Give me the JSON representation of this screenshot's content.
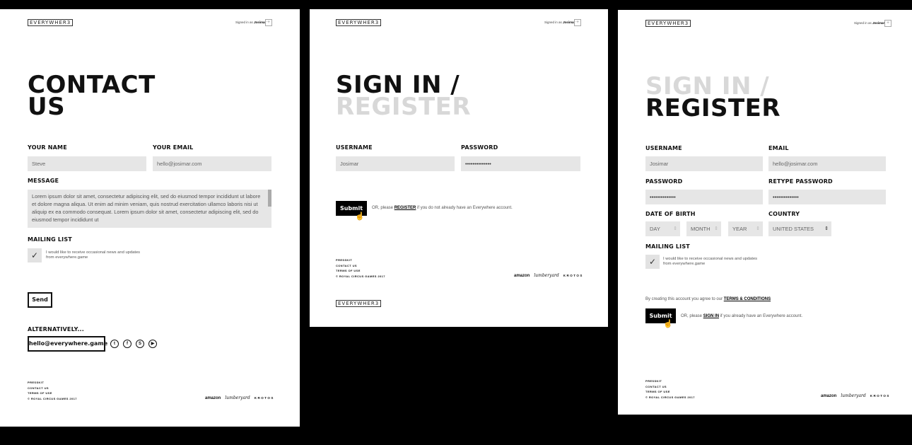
{
  "brand": {
    "logo": "EVERYWHER3"
  },
  "header": {
    "signed_in_prefix": "Signed in as",
    "user": "Josimar",
    "plus_icon": "+"
  },
  "contact": {
    "title_line1": "CONTACT",
    "title_line2": "US",
    "name_label": "YOUR NAME",
    "name_value": "Steve",
    "email_label": "YOUR EMAIL",
    "email_value": "hello@josimar.com",
    "message_label": "MESSAGE",
    "message_value": "Lorem ipsum dolor sit amet, consectetur adipiscing elit, sed do eiusmod tempor incididunt ut labore et dolore magna aliqua. Ut enim ad minim veniam, quis nostrud exercitation ullamco laboris nisi ut aliquip ex ea commodo consequat. Lorem ipsum dolor sit amet, consectetur adipiscing elit, sed do eiusmod tempor incididunt ut",
    "mailing_label": "MAILING LIST",
    "mailing_text": "I would like to receive occasional news and updates from everywhere.game",
    "mailing_checked": true,
    "send_label": "Send",
    "alt_label": "ALTERNATIVELY...",
    "alt_email": "hello@everywhere.game",
    "social": [
      {
        "name": "twitter-icon",
        "glyph": "t"
      },
      {
        "name": "facebook-icon",
        "glyph": "f"
      },
      {
        "name": "skype-icon",
        "glyph": "S"
      },
      {
        "name": "youtube-icon",
        "glyph": "▶"
      }
    ]
  },
  "signin": {
    "title_line1": "SIGN IN /",
    "title_line2": "REGISTER",
    "username_label": "USERNAME",
    "username_value": "Josimar",
    "password_label": "PASSWORD",
    "password_value": "••••••••••••••",
    "submit_label": "Submit",
    "or_prefix": "OR, please",
    "or_link": "REGISTER",
    "or_suffix": "if you do not already have an Everywhere account."
  },
  "register": {
    "title_line1": "SIGN IN /",
    "title_line2": "REGISTER",
    "username_label": "USERNAME",
    "username_value": "Josimar",
    "email_label": "EMAIL",
    "email_value": "hello@josimar.com",
    "password_label": "PASSWORD",
    "password_value": "••••••••••••••",
    "retype_label": "RETYPE PASSWORD",
    "retype_value": "••••••••••••••",
    "dob_label": "DATE OF BIRTH",
    "day": "DAY",
    "month": "MONTH",
    "year": "YEAR",
    "country_label": "COUNTRY",
    "country_value": "UNITED STATES",
    "mailing_label": "MAILING LIST",
    "mailing_text": "I would like to receive occasional news and updates from everywhere.game",
    "terms_prefix": "By creating this account you agree to our",
    "terms_link": "TERMS & CONDITIONS",
    "submit_label": "Submit",
    "or_prefix": "OR, please",
    "or_link": "SIGN IN",
    "or_suffix": "if you already have an Everywhere account."
  },
  "footer": {
    "links": [
      "PRESSKIT",
      "CONTACT US",
      "TERMS OF USE"
    ],
    "copyright": "© ROYAL CIRCUS GAMES 2017",
    "partners": [
      "amazon",
      "lumberyard",
      "KROTOS"
    ]
  },
  "icons": {
    "check": "✓",
    "cursor": "☝",
    "updown": "⇕"
  }
}
